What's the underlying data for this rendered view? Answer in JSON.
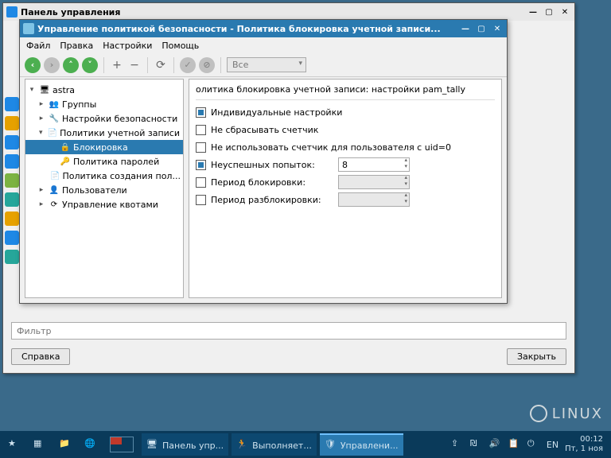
{
  "back_window": {
    "title": "Панель управления",
    "filter_placeholder": "Фильтр",
    "help_btn": "Справка",
    "close_btn": "Закрыть"
  },
  "front_window": {
    "title": "Управление политикой безопасности - Политика блокировка учетной записи...",
    "menu": {
      "file": "Файл",
      "edit": "Правка",
      "settings": "Настройки",
      "help": "Помощь"
    },
    "combo_value": "Все"
  },
  "tree": {
    "root": "astra",
    "groups": "Группы",
    "security": "Настройки безопасности",
    "account_policies": "Политики учетной записи",
    "lockout": "Блокировка",
    "password_policy": "Политика паролей",
    "creation_policy": "Политика создания пол...",
    "users": "Пользователи",
    "quota": "Управление квотами"
  },
  "content": {
    "title": "олитика блокировка учетной записи: настройки pam_tally",
    "individual": "Индивидуальные настройки",
    "no_reset": "Не сбрасывать счетчик",
    "no_uid0": "Не использовать счетчик для пользователя с uid=0",
    "failed_attempts": "Неуспешных попыток:",
    "failed_value": "8",
    "lock_period": "Период блокировки:",
    "unlock_period": "Период разблокировки:"
  },
  "taskbar": {
    "task1": "Панель упр...",
    "task2": "Выполняет...",
    "task3": "Управлени...",
    "lang": "EN",
    "time": "00:12",
    "date": "Пт, 1 ноя"
  },
  "wallpaper": "LINUX"
}
